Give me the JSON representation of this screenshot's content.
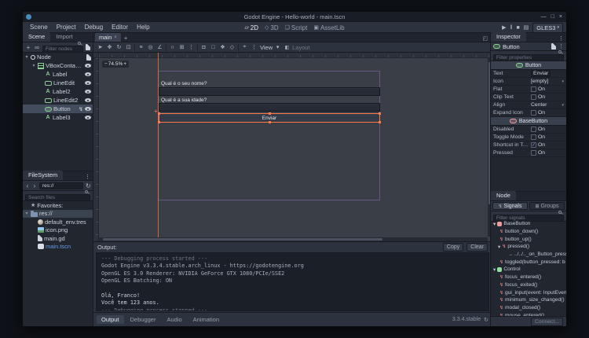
{
  "theme": {
    "accent": "#699ce8",
    "selection_orange": "#ff7a49"
  },
  "window": {
    "title": "Godot Engine - Hello-world - main.tscn"
  },
  "menubar": {
    "menus": [
      "Scene",
      "Project",
      "Debug",
      "Editor",
      "Help"
    ],
    "workspaces": [
      {
        "label": "2D",
        "icon": "2d",
        "active": true
      },
      {
        "label": "3D",
        "icon": "3d",
        "active": false
      },
      {
        "label": "Script",
        "icon": "script",
        "active": false
      },
      {
        "label": "AssetLib",
        "icon": "assetlib",
        "active": false
      }
    ],
    "play_controls": [
      "play",
      "pause",
      "stop",
      "movie"
    ],
    "renderer": "GLES3"
  },
  "scene_dock": {
    "tabs": [
      {
        "label": "Scene",
        "active": true
      },
      {
        "label": "Import",
        "active": false
      }
    ],
    "toolbar_icons": [
      "add-node",
      "instance-scene"
    ],
    "filter_placeholder": "Filter nodes",
    "toolbar_right_icons": [
      "attach-script"
    ],
    "tree": [
      {
        "label": "Node",
        "icon": "node",
        "depth": 0,
        "arrow": true,
        "script": true
      },
      {
        "label": "VBoxContainer",
        "icon": "vbox",
        "depth": 1,
        "arrow": true,
        "eye": true
      },
      {
        "label": "Label",
        "icon": "label",
        "depth": 2,
        "eye": true
      },
      {
        "label": "LineEdit",
        "icon": "lineedit",
        "depth": 2,
        "eye": true
      },
      {
        "label": "Label2",
        "icon": "label",
        "depth": 2,
        "eye": true
      },
      {
        "label": "LineEdit2",
        "icon": "lineedit",
        "depth": 2,
        "eye": true
      },
      {
        "label": "Button",
        "icon": "button",
        "depth": 2,
        "eye": true,
        "selected": true,
        "signal": true
      },
      {
        "label": "Label3",
        "icon": "label",
        "depth": 2,
        "eye": true
      }
    ]
  },
  "filesystem": {
    "tab_label": "FileSystem",
    "path": "res://",
    "search_placeholder": "Search files",
    "tree": [
      {
        "label": "Favorites:",
        "icon": "star",
        "depth": 0
      },
      {
        "label": "res://",
        "icon": "folder",
        "depth": 0,
        "arrow": true,
        "selected": true
      },
      {
        "label": "default_env.tres",
        "icon": "env",
        "depth": 1
      },
      {
        "label": "icon.png",
        "icon": "image",
        "depth": 1
      },
      {
        "label": "main.gd",
        "icon": "scriptfile",
        "depth": 1
      },
      {
        "label": "main.tscn",
        "icon": "scene",
        "depth": 1,
        "accent": true
      }
    ]
  },
  "scene_tabs": {
    "tabs": [
      {
        "label": "main",
        "active": true
      }
    ],
    "add_label": "+"
  },
  "canvas_toolbar": {
    "icons": [
      "select-tool",
      "move-tool",
      "rotate-tool",
      "scale-tool",
      "sep",
      "list-select-tool",
      "pivot-tool",
      "ruler-tool",
      "sep",
      "smart-snap",
      "grid-snap",
      "snap-menu",
      "sep",
      "lock",
      "unlock",
      "group",
      "ungroup",
      "sep",
      "skeleton",
      "snap-menu"
    ],
    "view_label": "View",
    "layout_label": "Layout"
  },
  "viewport": {
    "zoom_out": "−",
    "zoom_value": "74.5%",
    "zoom_in": "+",
    "label1_text": "Qual é o seu nome?",
    "label2_text": "Qual é a sua idade?",
    "button_text": "Enviar"
  },
  "output": {
    "title": "Output:",
    "copy_label": "Copy",
    "clear_label": "Clear",
    "lines": [
      {
        "text": "--- Debugging process started ---",
        "style": "dim"
      },
      {
        "text": "Godot Engine v3.3.4.stable.arch_linux - https://godotengine.org",
        "style": "normal"
      },
      {
        "text": "OpenGL ES 3.0 Renderer: NVIDIA GeForce GTX 1080/PCIe/SSE2",
        "style": "normal"
      },
      {
        "text": "OpenGL ES Batching: ON",
        "style": "normal"
      },
      {
        "text": "",
        "style": "normal"
      },
      {
        "text": "Olá, Franco!",
        "style": "bright"
      },
      {
        "text": "Você tem 123 anos.",
        "style": "bright"
      },
      {
        "text": "--- Debugging process stopped ---",
        "style": "dim"
      }
    ]
  },
  "status_bar": {
    "tabs": [
      {
        "label": "Output",
        "active": true
      },
      {
        "label": "Debugger",
        "active": false
      },
      {
        "label": "Audio",
        "active": false
      },
      {
        "label": "Animation",
        "active": false
      }
    ],
    "version": "3.3.4.stable"
  },
  "inspector": {
    "tab_label": "Inspector",
    "node_name": "Button",
    "filter_placeholder": "Filter properties",
    "rows": [
      {
        "type": "category",
        "label": "Button",
        "icon": "button"
      },
      {
        "type": "text",
        "name": "Text",
        "value": "Enviar"
      },
      {
        "type": "dropdown",
        "name": "Icon",
        "value": "[empty]"
      },
      {
        "type": "check",
        "name": "Flat",
        "value": "On",
        "checked": false
      },
      {
        "type": "check",
        "name": "Clip Text",
        "value": "On",
        "checked": false
      },
      {
        "type": "dropdown",
        "name": "Align",
        "value": "Center"
      },
      {
        "type": "check",
        "name": "Expand Icon",
        "value": "On",
        "checked": false
      },
      {
        "type": "category",
        "label": "BaseButton",
        "icon": "basebutton"
      },
      {
        "type": "check",
        "name": "Disabled",
        "value": "On",
        "checked": false
      },
      {
        "type": "check",
        "name": "Toggle Mode",
        "value": "On",
        "checked": false
      },
      {
        "type": "check",
        "name": "Shortcut in Tool",
        "value": "On",
        "checked": true
      },
      {
        "type": "check",
        "name": "Pressed",
        "value": "On",
        "checked": false
      }
    ]
  },
  "node_dock": {
    "tab_label": "Node",
    "tabs": [
      {
        "label": "Signals",
        "icon": "signals",
        "active": true
      },
      {
        "label": "Groups",
        "icon": "groups",
        "active": false
      }
    ],
    "filter_placeholder": "Filter signals",
    "connect_label": "Connect...",
    "tree": [
      {
        "type": "class",
        "label": "BaseButton",
        "color": "#f09a9a"
      },
      {
        "type": "signal",
        "label": "button_down()"
      },
      {
        "type": "signal",
        "label": "button_up()"
      },
      {
        "type": "signal",
        "label": "pressed()",
        "expanded": true
      },
      {
        "type": "slot",
        "label": "../../.._on_Button_presse"
      },
      {
        "type": "signal",
        "label": "toggled(button_pressed: b"
      },
      {
        "type": "class",
        "label": "Control",
        "color": "#8fdf9a"
      },
      {
        "type": "signal",
        "label": "focus_entered()"
      },
      {
        "type": "signal",
        "label": "focus_exited()"
      },
      {
        "type": "signal",
        "label": "gui_input(event: InputEven"
      },
      {
        "type": "signal",
        "label": "minimum_size_changed()"
      },
      {
        "type": "signal",
        "label": "modal_closed()"
      },
      {
        "type": "signal",
        "label": "mouse_entered()"
      }
    ]
  }
}
